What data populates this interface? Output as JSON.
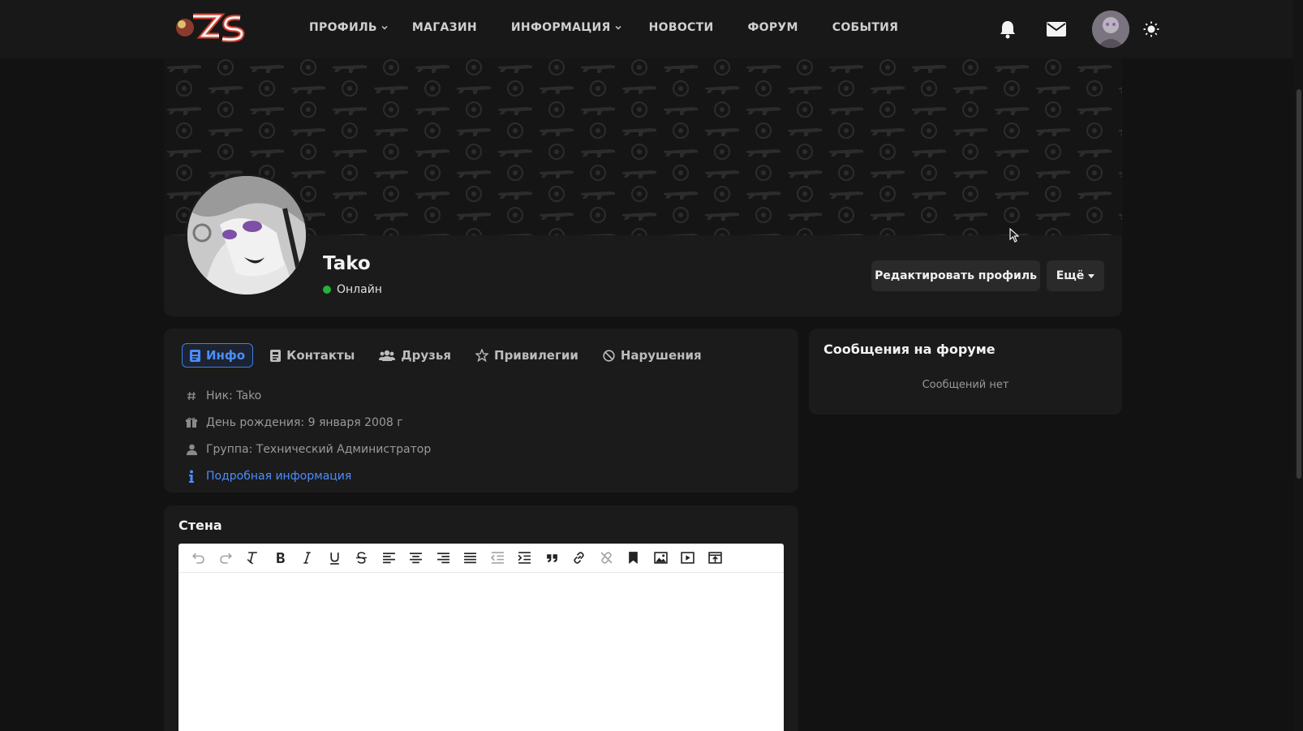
{
  "nav": {
    "logo_text": "ZS",
    "items": [
      {
        "label": "ПРОФИЛЬ",
        "has_dropdown": true
      },
      {
        "label": "МАГАЗИН",
        "has_dropdown": false
      },
      {
        "label": "ИНФОРМАЦИЯ",
        "has_dropdown": true
      },
      {
        "label": "НОВОСТИ",
        "has_dropdown": false
      },
      {
        "label": "ФОРУМ",
        "has_dropdown": false
      },
      {
        "label": "СОБЫТИЯ",
        "has_dropdown": false
      }
    ],
    "right_icons": [
      "bell-icon",
      "envelope-icon",
      "user-avatar",
      "sun-icon"
    ]
  },
  "profile": {
    "username": "Tako",
    "status_text": "Онлайн",
    "status_color": "#23b33a",
    "edit_button": "Редактировать профиль",
    "more_button": "Ещё"
  },
  "tabs": [
    {
      "label": "Инфо",
      "icon": "id-card-icon",
      "active": true
    },
    {
      "label": "Контакты",
      "icon": "address-book-icon",
      "active": false
    },
    {
      "label": "Друзья",
      "icon": "users-icon",
      "active": false
    },
    {
      "label": "Привилегии",
      "icon": "star-icon",
      "active": false
    },
    {
      "label": "Нарушения",
      "icon": "ban-icon",
      "active": false
    }
  ],
  "info": {
    "nick": "Ник: Tako",
    "birthday": "День рождения: 9 января 2008 г",
    "group": "Группа: Технический Администратор",
    "details_link": "Подробная информация"
  },
  "forum": {
    "title": "Сообщения на форуме",
    "empty_text": "Сообщений нет"
  },
  "wall": {
    "title": "Стена",
    "toolbar": [
      "undo-icon",
      "redo-icon",
      "clear-format-icon",
      "bold-icon",
      "italic-icon",
      "underline-icon",
      "strikethrough-icon",
      "align-left-icon",
      "align-center-icon",
      "align-right-icon",
      "align-justify-icon",
      "outdent-icon",
      "indent-icon",
      "blockquote-icon",
      "link-icon",
      "unlink-icon",
      "bookmark-icon",
      "image-icon",
      "video-icon",
      "embed-icon"
    ]
  },
  "colors": {
    "accent": "#4a8dff",
    "background": "#121212",
    "card": "#1b1b1b"
  }
}
